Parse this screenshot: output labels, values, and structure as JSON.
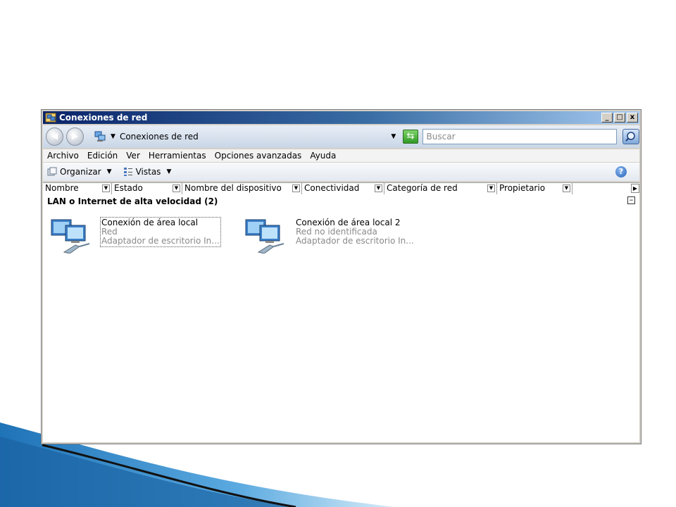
{
  "window": {
    "title": "Conexiones de red",
    "controls": {
      "minimize": "_",
      "maximize": "□",
      "close": "x"
    }
  },
  "address": {
    "location": "Conexiones de red",
    "search_placeholder": "Buscar"
  },
  "menubar": [
    "Archivo",
    "Edición",
    "Ver",
    "Herramientas",
    "Opciones avanzadas",
    "Ayuda"
  ],
  "toolbar": {
    "organize_label": "Organizar",
    "views_label": "Vistas"
  },
  "columns": [
    "Nombre",
    "Estado",
    "Nombre del dispositivo",
    "Conectividad",
    "Categoría de red",
    "Propietario"
  ],
  "group": {
    "title": "LAN o Internet de alta velocidad (2)"
  },
  "connections": [
    {
      "name": "Conexión de área local",
      "status": "Red",
      "device": "Adaptador de escritorio In...",
      "selected": true
    },
    {
      "name": "Conexión de área local 2",
      "status": "Red no identificada",
      "device": "Adaptador de escritorio In...",
      "selected": false
    }
  ],
  "colors": {
    "titlebar_start": "#0a246a",
    "titlebar_end": "#a6caf0",
    "slide_accent": "#1f73b7"
  }
}
